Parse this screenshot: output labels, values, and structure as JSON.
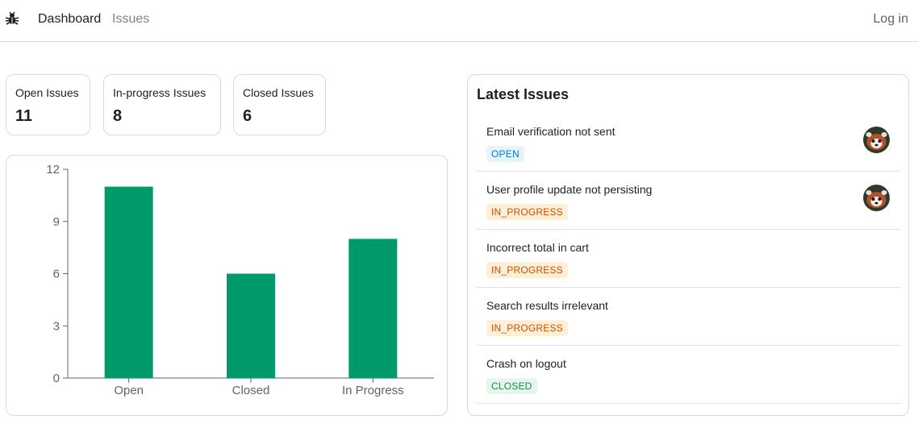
{
  "nav": {
    "logo_icon": "bug-icon",
    "links": [
      "Dashboard",
      "Issues"
    ],
    "login_label": "Log in"
  },
  "summary": [
    {
      "label": "Open Issues",
      "value": "11"
    },
    {
      "label": "In-progress Issues",
      "value": "8"
    },
    {
      "label": "Closed Issues",
      "value": "6"
    }
  ],
  "colors": {
    "bar": "#00996b",
    "open_badge": "#0d74ce",
    "in_progress_badge": "#cc4e00",
    "closed_badge": "#218358"
  },
  "chart_data": {
    "type": "bar",
    "categories": [
      "Open",
      "Closed",
      "In Progress"
    ],
    "values": [
      11,
      6,
      8
    ],
    "ylim": [
      0,
      12
    ],
    "yticks": [
      0,
      3,
      6,
      9,
      12
    ],
    "ytick_labels": [
      "0",
      "3",
      "6",
      "9",
      "12"
    ],
    "title": "",
    "xlabel": "",
    "ylabel": "",
    "grid": false
  },
  "latest": {
    "title": "Latest Issues",
    "issues": [
      {
        "title": "Email verification not sent",
        "status": "OPEN",
        "assigned_avatar": true
      },
      {
        "title": "User profile update not persisting",
        "status": "IN_PROGRESS",
        "assigned_avatar": true
      },
      {
        "title": "Incorrect total in cart",
        "status": "IN_PROGRESS",
        "assigned_avatar": false
      },
      {
        "title": "Search results irrelevant",
        "status": "IN_PROGRESS",
        "assigned_avatar": false
      },
      {
        "title": "Crash on logout",
        "status": "CLOSED",
        "assigned_avatar": false
      }
    ]
  }
}
